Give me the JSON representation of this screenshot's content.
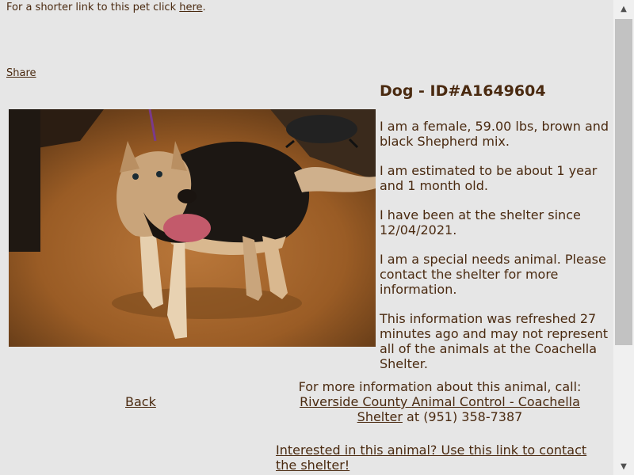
{
  "top_link": {
    "prefix": "For a shorter link to this pet click ",
    "link_text": "here",
    "suffix": "."
  },
  "share_label": "Share",
  "pet": {
    "title": "Dog - ID#A1649604",
    "details": [
      "I am a female, 59.00 lbs, brown and black Shepherd mix.",
      "I am estimated to be about 1 year and 1 month old.",
      "I have been at the shelter since 12/04/2021.",
      "I am a special needs animal. Please contact the shelter for more information.",
      "This information was refreshed 27 minutes ago and may not represent all of the animals at the Coachella Shelter."
    ]
  },
  "back_label": "Back",
  "contact": {
    "intro": "For more information about this animal, call:",
    "shelter_link": "Riverside County Animal Control - Coachella Shelter",
    "phone_text": " at (951) 358-7387"
  },
  "interested_link": "Interested in this animal? Use this link to contact the shelter!",
  "colors": {
    "background": "#e6e6e6",
    "text": "#4a2a10"
  }
}
